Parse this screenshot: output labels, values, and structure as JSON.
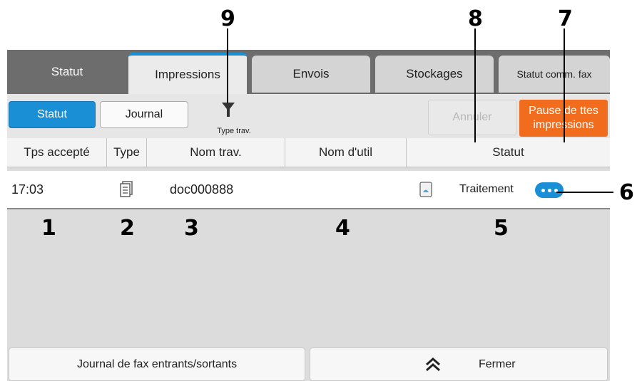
{
  "tabs": [
    {
      "label": "Statut",
      "active": false
    },
    {
      "label": "Impressions",
      "active": true
    },
    {
      "label": "Envois",
      "active": false
    },
    {
      "label": "Stockages",
      "active": false
    },
    {
      "label": "Statut comm. fax",
      "active": false
    }
  ],
  "toolbar": {
    "status_label": "Statut",
    "journal_label": "Journal",
    "filter_label": "Type trav.",
    "cancel_label": "Annuler",
    "pause_label": "Pause de ttes impressions"
  },
  "table": {
    "columns": [
      "Tps accepté",
      "Type",
      "Nom trav.",
      "Nom d'util",
      "Statut"
    ],
    "rows": [
      {
        "time": "17:03",
        "type_icon": "document-stack-icon",
        "job_name": "doc000888",
        "user_name": "",
        "status_icon": "paper-icon",
        "status": "Traitement"
      }
    ]
  },
  "bottom": {
    "fax_log_label": "Journal de fax entrants/sortants",
    "close_label": "Fermer"
  },
  "callouts": [
    "1",
    "2",
    "3",
    "4",
    "5",
    "6",
    "7",
    "8",
    "9"
  ],
  "colors": {
    "accent_blue": "#1a8fd6",
    "pause_orange": "#f26c1d",
    "tab_bar": "#6d6d6d"
  }
}
